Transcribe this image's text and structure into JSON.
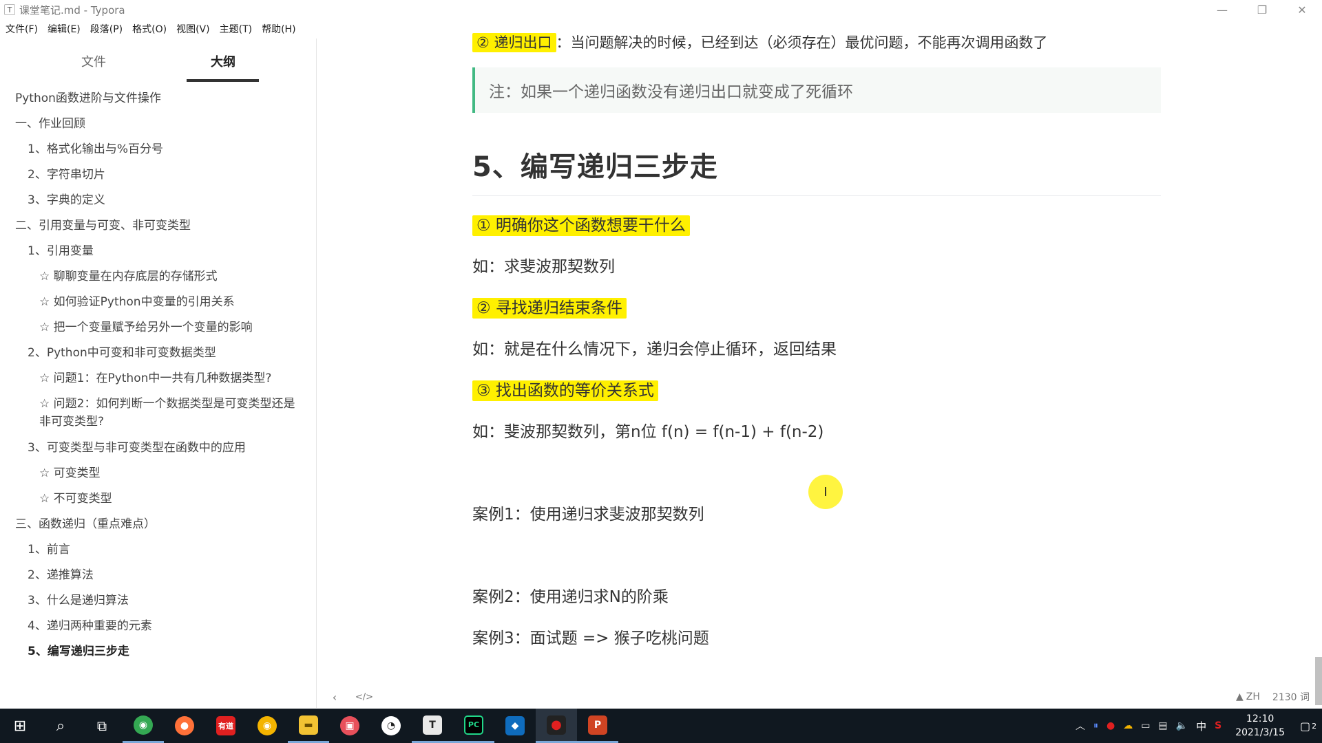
{
  "window": {
    "title": "课堂笔记.md - Typora",
    "app_icon": "T",
    "controls": {
      "minimize": "—",
      "restore": "❐",
      "close": "✕"
    }
  },
  "menu": [
    "文件(F)",
    "编辑(E)",
    "段落(P)",
    "格式(O)",
    "视图(V)",
    "主题(T)",
    "帮助(H)"
  ],
  "sidebar": {
    "tabs": [
      {
        "label": "文件",
        "active": false
      },
      {
        "label": "大纲",
        "active": true
      }
    ],
    "outline": [
      "Python函数进阶与文件操作",
      "一、作业回顾",
      "1、格式化输出与%百分号",
      "2、字符串切片",
      "3、字典的定义",
      "二、引用变量与可变、非可变类型",
      "1、引用变量",
      "☆ 聊聊变量在内存底层的存储形式",
      "☆ 如何验证Python中变量的引用关系",
      "☆ 把一个变量赋予给另外一个变量的影响",
      "2、Python中可变和非可变数据类型",
      "☆ 问题1：在Python中一共有几种数据类型?",
      "☆ 问题2：如何判断一个数据类型是可变类型还是非可变类型?",
      "3、可变类型与非可变类型在函数中的应用",
      "☆ 可变类型",
      "☆ 不可变类型",
      "三、函数递归（重点难点）",
      "1、前言",
      "2、递推算法",
      "3、什么是递归算法",
      "4、递归两种重要的元素",
      "5、编写递归三步走"
    ]
  },
  "content": {
    "top_highlight": "② 递归出口",
    "top_rest": "：当问题解决的时候，已经到达（必须存在）最优问题，不能再次调用函数了",
    "quote": "注：如果一个递归函数没有递归出口就变成了死循环",
    "heading": "5、编写递归三步走",
    "step1": "① 明确你这个函数想要干什么",
    "step1_example": "如：求斐波那契数列",
    "step2": "② 寻找递归结束条件",
    "step2_example": "如：就是在什么情况下，递归会停止循环，返回结果",
    "step3": "③ 找出函数的等价关系式",
    "step3_example": "如：斐波那契数列，第n位 f(n) = f(n-1) + f(n-2)",
    "case1": "案例1：使用递归求斐波那契数列",
    "case2": "案例2：使用递归求N的阶乘",
    "case3": "案例3：面试题 => 猴子吃桃问题",
    "cursor": "I"
  },
  "statusbar": {
    "back": "‹",
    "source": "</>",
    "lang": "ZH",
    "word_count": "2130 词"
  },
  "taskbar": {
    "start_icon": "windows-icon",
    "apps": [
      {
        "name": "search",
        "glyph": "⌕",
        "color": "#101820"
      },
      {
        "name": "task-view",
        "glyph": "⧉",
        "color": "#101820"
      },
      {
        "name": "chrome",
        "glyph": "◉",
        "color": "#34a853"
      },
      {
        "name": "firefox",
        "glyph": "●",
        "color": "#ff7139"
      },
      {
        "name": "youdao",
        "glyph": "有道",
        "color": "#e02020"
      },
      {
        "name": "chrome-canary",
        "glyph": "◉",
        "color": "#f4b400"
      },
      {
        "name": "file-explorer",
        "glyph": "▬",
        "color": "#f2c233"
      },
      {
        "name": "screen-recorder",
        "glyph": "▣",
        "color": "#e8505b"
      },
      {
        "name": "clock-app",
        "glyph": "◔",
        "color": "#ffffff"
      },
      {
        "name": "typora",
        "glyph": "T",
        "color": "#e9e9e9"
      },
      {
        "name": "pycharm",
        "glyph": "PC",
        "color": "#21d789"
      },
      {
        "name": "vscode",
        "glyph": "◆",
        "color": "#0f6cbd"
      },
      {
        "name": "recorder",
        "glyph": "●",
        "color": "#222"
      },
      {
        "name": "powerpoint",
        "glyph": "P",
        "color": "#d04423"
      }
    ],
    "ime": "中",
    "time": "12:10",
    "date": "2021/3/15",
    "notification_count": "2"
  }
}
